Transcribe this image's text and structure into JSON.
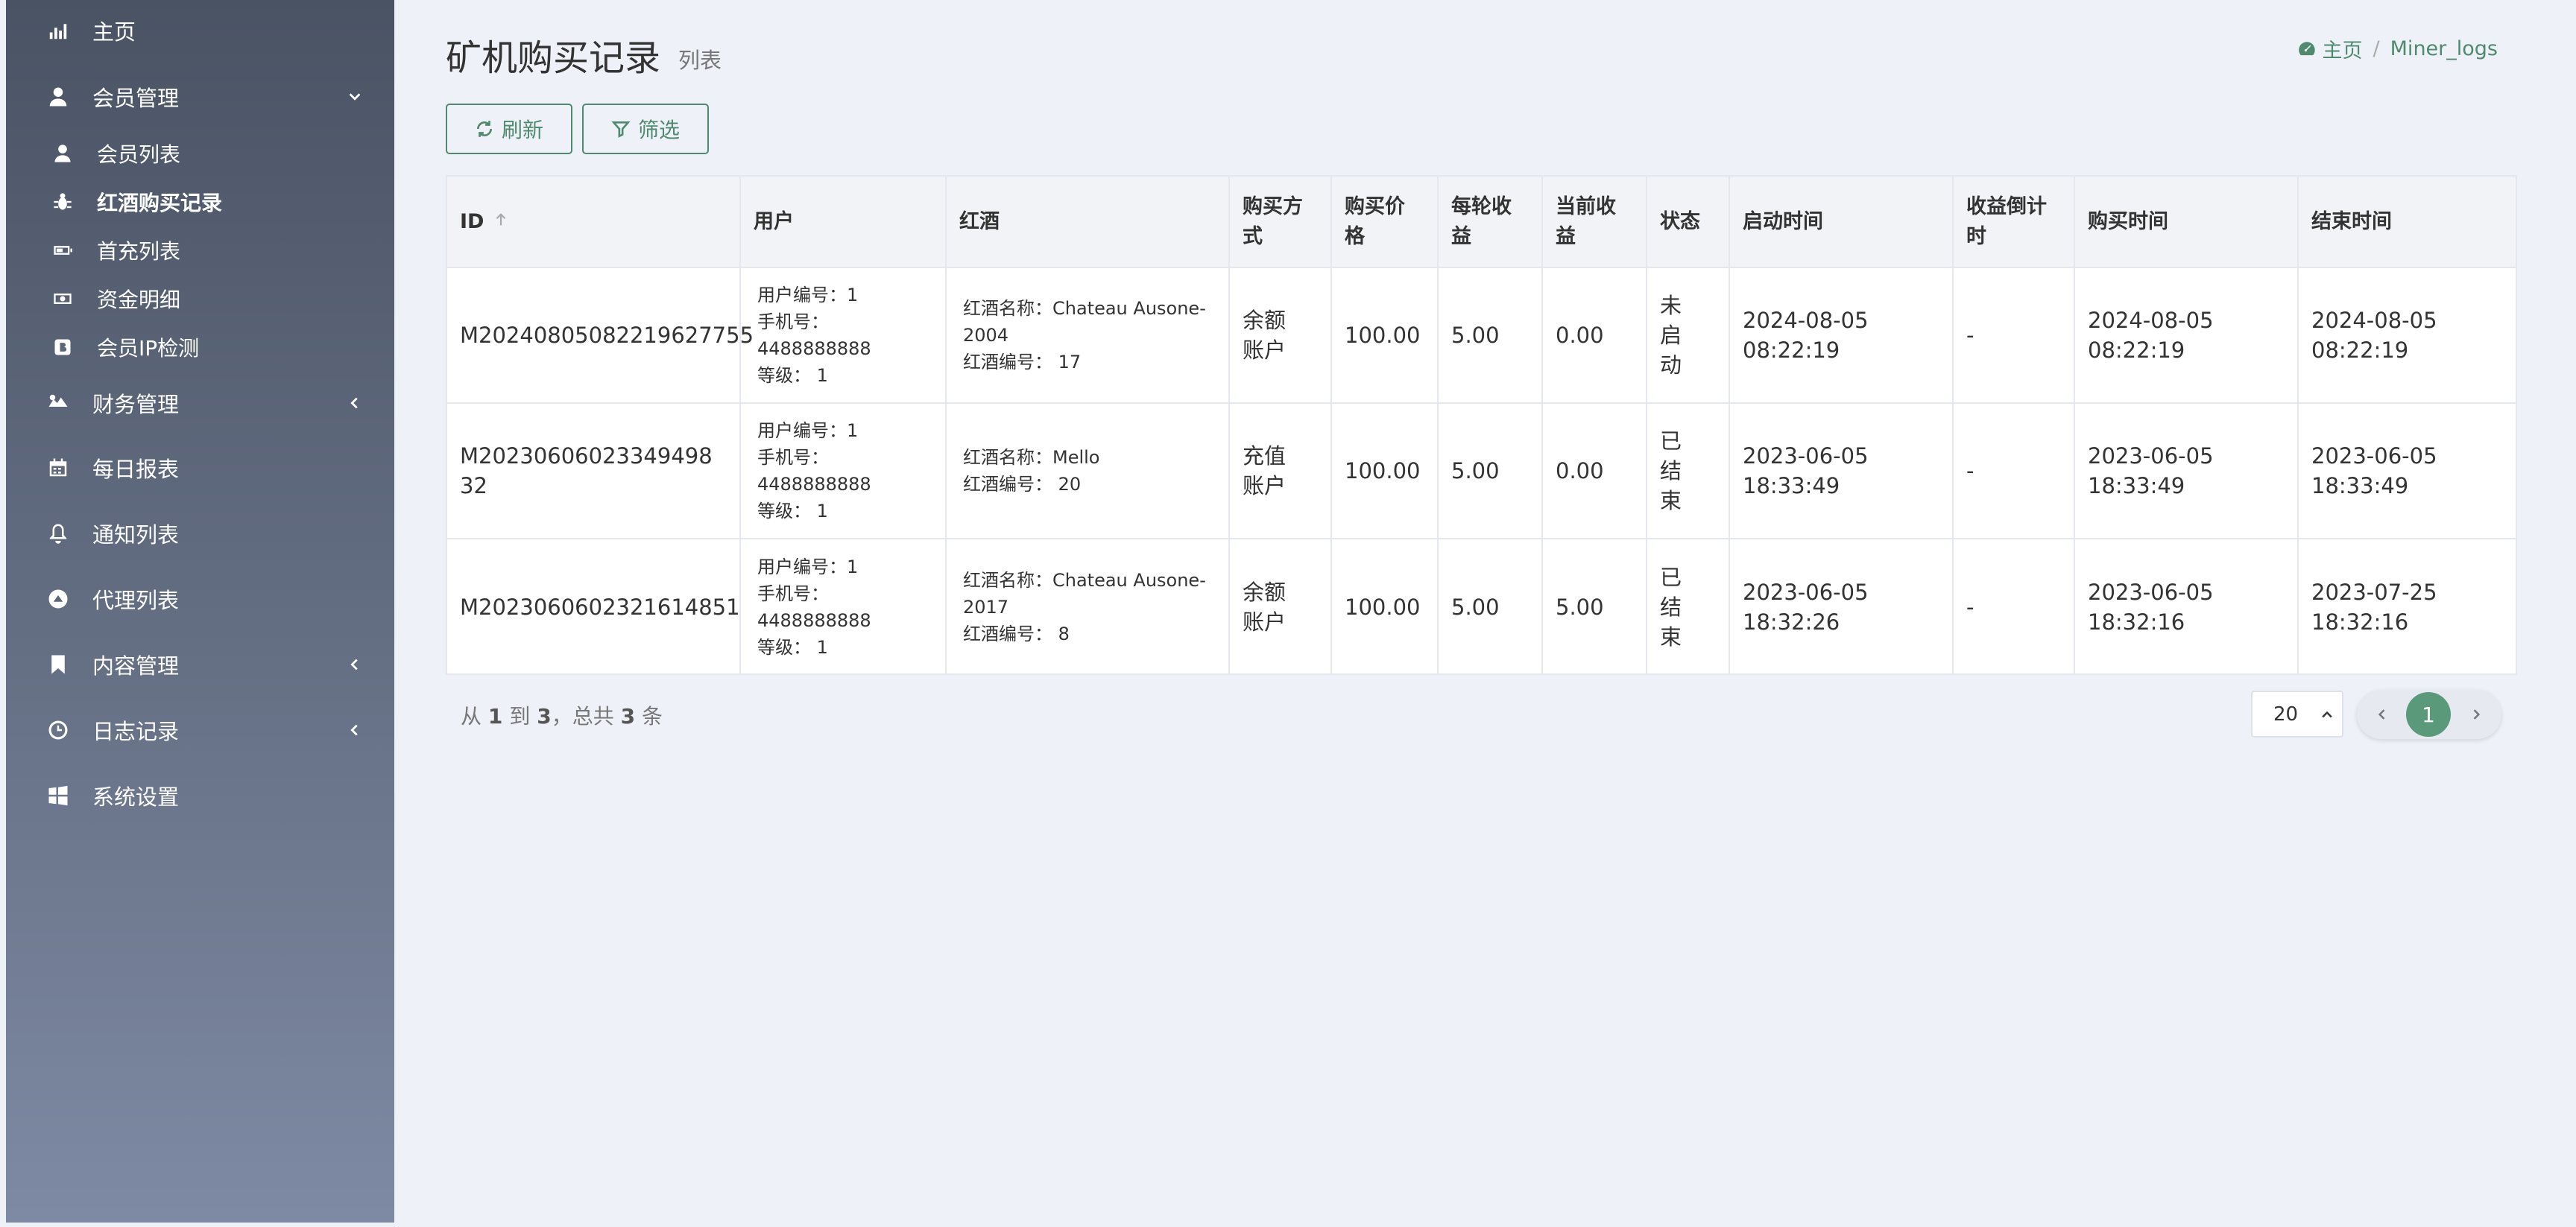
{
  "sidebar": {
    "items": [
      {
        "label": "主页",
        "icon": "bar-chart-icon"
      },
      {
        "label": "会员管理",
        "icon": "user-icon"
      },
      {
        "label": "财务管理",
        "icon": "money-icon"
      },
      {
        "label": "每日报表",
        "icon": "calendar-icon"
      },
      {
        "label": "通知列表",
        "icon": "bell-icon"
      },
      {
        "label": "代理列表",
        "icon": "agent-icon"
      },
      {
        "label": "内容管理",
        "icon": "bookmark-icon"
      },
      {
        "label": "日志记录",
        "icon": "clock-icon"
      },
      {
        "label": "系统设置",
        "icon": "windows-icon"
      }
    ],
    "subitems": [
      {
        "label": "会员列表",
        "icon": "user-icon"
      },
      {
        "label": "红酒购买记录",
        "icon": "bug-icon",
        "active": true
      },
      {
        "label": "首充列表",
        "icon": "battery-icon"
      },
      {
        "label": "资金明细",
        "icon": "money-icon"
      },
      {
        "label": "会员IP检测",
        "icon": "bitcoin-icon"
      }
    ]
  },
  "header": {
    "title": "矿机购买记录",
    "subtitle": "列表",
    "breadcrumb_home": "主页",
    "breadcrumb_current": "Miner_logs"
  },
  "toolbar": {
    "refresh_label": "刷新",
    "filter_label": "筛选"
  },
  "table": {
    "columns": [
      "ID",
      "用户",
      "红酒",
      "购买方式",
      "购买价格",
      "每轮收益",
      "当前收益",
      "状态",
      "启动时间",
      "收益倒计时",
      "购买时间",
      "结束时间"
    ],
    "rows": [
      {
        "id": "M20240805082219627755",
        "user": {
          "no": "用户编号：1",
          "phone_label": "手机号：",
          "phone": "4488888888",
          "level": "等级： 1"
        },
        "wine": {
          "name": "红酒名称：Chateau Ausone-2004",
          "no": "红酒编号： 17"
        },
        "method": "余额账户",
        "price": "100.00",
        "per_round": "5.00",
        "current": "0.00",
        "status": "未启动",
        "start": "2024-08-05 08:22:19",
        "countdown": "-",
        "buy_time": "2024-08-05 08:22:19",
        "end_time": "2024-08-05 08:22:19"
      },
      {
        "id": "M20230606023349498 32",
        "user": {
          "no": "用户编号：1",
          "phone_label": "手机号：",
          "phone": "4488888888",
          "level": "等级： 1"
        },
        "wine": {
          "name": "红酒名称：Mello",
          "no": "红酒编号： 20"
        },
        "method": "充值账户",
        "price": "100.00",
        "per_round": "5.00",
        "current": "0.00",
        "status": "已结束",
        "start": "2023-06-05 18:33:49",
        "countdown": "-",
        "buy_time": "2023-06-05 18:33:49",
        "end_time": "2023-06-05 18:33:49"
      },
      {
        "id": "M2023060602321614851",
        "user": {
          "no": "用户编号：1",
          "phone_label": "手机号：",
          "phone": "4488888888",
          "level": "等级： 1"
        },
        "wine": {
          "name": "红酒名称：Chateau Ausone-2017",
          "no": "红酒编号： 8"
        },
        "method": "余额账户",
        "price": "100.00",
        "per_round": "5.00",
        "current": "5.00",
        "status": "已结束",
        "start": "2023-06-05 18:32:26",
        "countdown": "-",
        "buy_time": "2023-06-05 18:32:16",
        "end_time": "2023-07-25 18:32:16"
      }
    ]
  },
  "footer": {
    "from_label": "从",
    "from": "1",
    "to_label": "到",
    "to": "3",
    "total_label": "，总共",
    "total": "3",
    "unit": "条",
    "per_page": "20",
    "current_page": "1"
  },
  "colors": {
    "accent": "#4f8a6e",
    "page_active": "#5a9a7a",
    "background": "#eef1f7"
  }
}
